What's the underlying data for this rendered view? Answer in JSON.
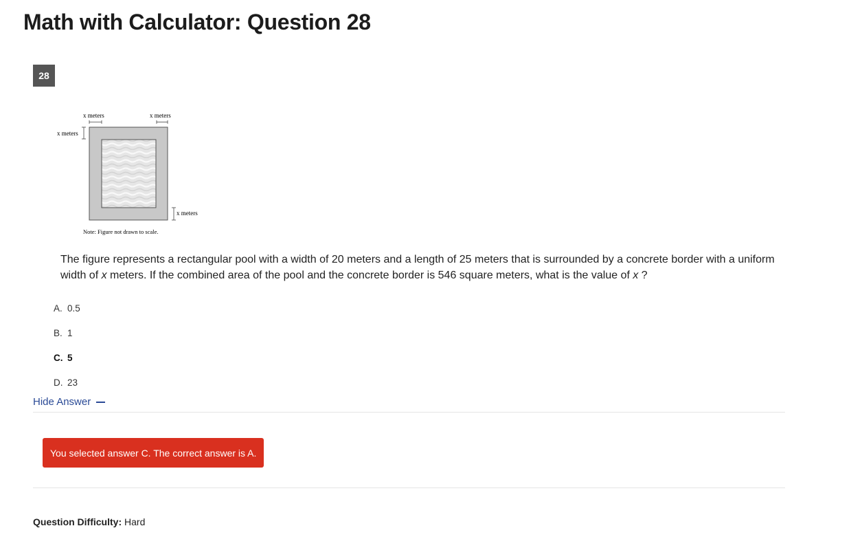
{
  "header": {
    "title": "Math with Calculator: Question 28"
  },
  "question": {
    "number": "28",
    "figure": {
      "label_top_left": "x meters",
      "label_top_right": "x meters",
      "label_left": "x meters",
      "label_bottom_right": "x meters",
      "note": "Note: Figure not drawn to scale."
    },
    "text_part1": "The figure represents a rectangular pool with a width of 20 meters and a length of 25 meters that is surrounded by a concrete border with a uniform width of ",
    "var1": "x",
    "text_part2": " meters. If the combined area of the pool and the concrete border is 546 square meters, what is the value of ",
    "var2": "x",
    "text_part3": " ?",
    "choices": [
      {
        "letter": "A.",
        "value": "0.5"
      },
      {
        "letter": "B.",
        "value": "1"
      },
      {
        "letter": "C.",
        "value": "5"
      },
      {
        "letter": "D.",
        "value": "23"
      }
    ],
    "selected_choice": "C"
  },
  "answer": {
    "toggle_label": "Hide Answer",
    "feedback": "You selected answer C. The correct answer is A.",
    "feedback_color": "#d9301f"
  },
  "difficulty": {
    "label": "Question Difficulty:",
    "value": "Hard"
  }
}
